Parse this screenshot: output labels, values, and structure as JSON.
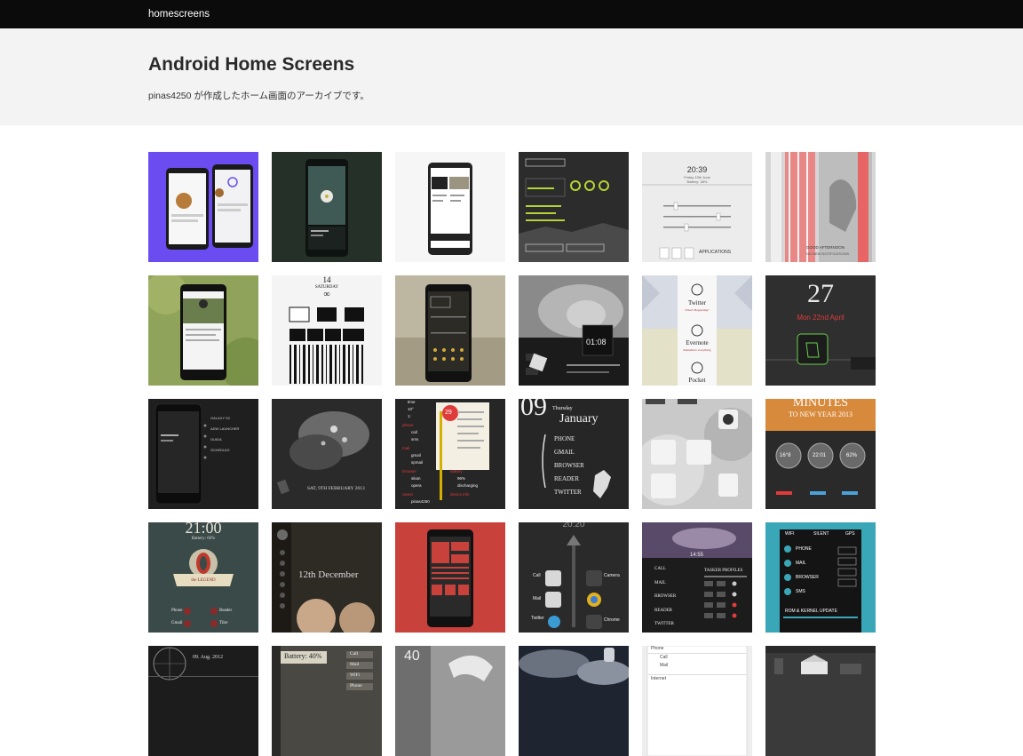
{
  "nav": {
    "brand": "homescreens"
  },
  "header": {
    "title": "Android Home Screens",
    "subtitle": "pinas4250 が作成したホーム画面のアーカイブです。"
  },
  "thumbs": {
    "t4": {
      "clock": "20:39",
      "date": "Friday 13th June",
      "battery": "Battery: 38%",
      "apps": "APPLICATIONS"
    },
    "t5": {
      "line1": "GOOD AFTERNOON",
      "line2": "NO NEW NOTIFICATIONS"
    },
    "t7": {
      "day": "14",
      "weekday": "SATURDAY",
      "sym": "∞"
    },
    "t9": {
      "time": "01:08"
    },
    "t10": {
      "app1": "Twitter",
      "sub1": "What's Happening?",
      "app2": "Evernote",
      "sub2": "Remember everything",
      "app3": "Pocket"
    },
    "t11": {
      "day": "27",
      "date": "Mon 22nd April"
    },
    "t12": {
      "apps": [
        "GALAXY S2",
        "ADW LAUNCHER",
        "GUIDA",
        "SCHEDULE"
      ]
    },
    "t13": {
      "date": "SAT, 9TH FEBRUARY 2013"
    },
    "t14": {
      "left": [
        "time",
        "10°",
        "1:",
        "phone",
        "call",
        "sms",
        "mail",
        "gmail",
        "spmail",
        "browser",
        "sikan",
        "opera",
        "owner",
        "pinas4250"
      ],
      "right": [
        "battery",
        "96%",
        "discharging",
        "device info"
      ],
      "day": "29"
    },
    "t15": {
      "big": "09",
      "month": "January",
      "day": "Thursday",
      "items": [
        "PHONE",
        "GMAIL",
        "BROWSER",
        "READER",
        "TWITTER"
      ]
    },
    "t17": {
      "title": "MINUTES",
      "sub": "TO NEW YEAR 2013",
      "vals": [
        "16°8",
        "22:01",
        "62%"
      ]
    },
    "t18": {
      "time": "21:00",
      "battery": "Battery: 66%",
      "ribbon": "the LEGEND",
      "apps": [
        "Phone",
        "Reader",
        "Gmail",
        "Tiler"
      ]
    },
    "t19": {
      "date": "12th December"
    },
    "t21": {
      "time": "20:20",
      "apps": [
        "Call",
        "Camera",
        "Mail",
        "Chrome",
        "Twitter"
      ]
    },
    "t22": {
      "time": "14:55",
      "items": [
        "CALL",
        "MAIL",
        "BROWSER",
        "READER",
        "TWITTER"
      ],
      "profiles": "TASKER PROFILES"
    },
    "t23": {
      "tabs": [
        "WIFI",
        "SILENT",
        "GPS"
      ],
      "items": [
        "PHONE",
        "MAIL",
        "BROWSER",
        "SMS"
      ],
      "kernel": "ROM & KERNEL UPDATE"
    },
    "t24": {
      "date": "09. Aug. 2012"
    },
    "t25": {
      "battery": "Battery: 40%",
      "tabs": [
        "Call",
        "Mail",
        "WiFi",
        "Phone"
      ]
    },
    "t26": {
      "time": "40"
    },
    "t28": {
      "items": [
        "Phone",
        "Call",
        "Mail",
        "Internet"
      ]
    }
  },
  "colors": {
    "navbar": "#0b0b0b",
    "header_bg": "#f3f3f3",
    "accent_red": "#e03b3b",
    "accent_lime": "#b5d335"
  }
}
